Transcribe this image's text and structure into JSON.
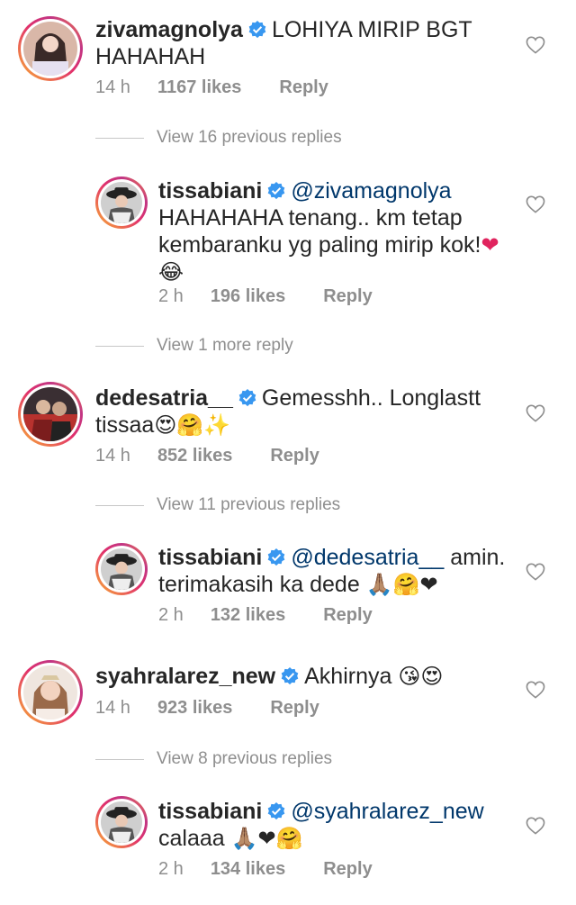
{
  "comments": [
    {
      "username": "zivamagnolya",
      "text": "LOHIYA MIRIP BGT",
      "text2": "HAHAHAH",
      "time": "14 h",
      "likes": "1167 likes",
      "reply": "Reply"
    },
    {
      "view_label": "View 16 previous replies"
    },
    {
      "username": "tissabiani",
      "mention": "@zivamagnolya",
      "text": "HAHAHAHA tenang.. km tetap",
      "text2": "kembaranku yg paling mirip kok!",
      "emoji_heart": "❤",
      "emoji_line3": "😂",
      "time": "2 h",
      "likes": "196 likes",
      "reply": "Reply"
    },
    {
      "view_label": "View 1 more reply"
    },
    {
      "username": "dedesatria__",
      "text": "Gemesshh.. Longlastt",
      "text2": "tissaa",
      "emojis": "😍🤗✨",
      "time": "14 h",
      "likes": "852 likes",
      "reply": "Reply"
    },
    {
      "view_label": "View 11 previous replies"
    },
    {
      "username": "tissabiani",
      "mention": "@dedesatria__",
      "text_after_mention": " amin.",
      "text2": "terimakasih ka dede",
      "emojis": "🙏🏽🤗❤",
      "time": "2 h",
      "likes": "132 likes",
      "reply": "Reply"
    },
    {
      "username": "syahralarez_new",
      "text": "Akhirnya",
      "emojis": "😘😍",
      "time": "14 h",
      "likes": "923 likes",
      "reply": "Reply"
    },
    {
      "view_label": "View 8 previous replies"
    },
    {
      "username": "tissabiani",
      "mention": "@syahralarez_new",
      "text2": "calaaa",
      "emojis": "🙏🏽❤🤗",
      "time": "2 h",
      "likes": "134 likes",
      "reply": "Reply"
    }
  ],
  "icons": {
    "verified": "verified-badge-icon",
    "heart": "heart-outline-icon"
  },
  "colors": {
    "verified": "#3897f0",
    "mention": "#00376b",
    "meta": "#8e8e8e",
    "heart_red": "#e0245e"
  }
}
